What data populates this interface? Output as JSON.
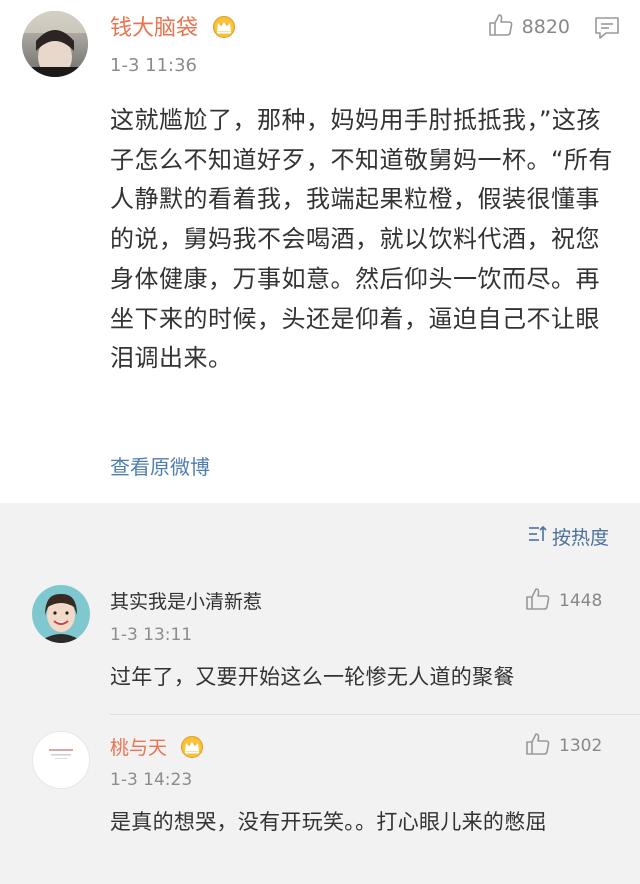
{
  "post": {
    "username": "钱大脑袋",
    "vip_icon": "crown-badge-icon",
    "timestamp": "1-3 11:36",
    "like_count": "8820",
    "body": "这就尴尬了，那种，妈妈用手肘抵抵我，”这孩子怎么不知道好歹，不知道敬舅妈一杯。“所有人静默的看着我，我端起果粒橙，假装很懂事的说，舅妈我不会喝酒，就以饮料代酒，祝您身体健康，万事如意。然后仰头一饮而尽。再坐下来的时候，头还是仰着，逼迫自己不让眼泪调出来。",
    "view_original": "查看原微博"
  },
  "sort": {
    "label": "按热度"
  },
  "comments": [
    {
      "username": "其实我是小清新惹",
      "timestamp": "1-3 13:11",
      "like_count": "1448",
      "text": "过年了，又要开始这么一轮惨无人道的聚餐"
    },
    {
      "username": "桃与天",
      "timestamp": "1-3 14:23",
      "like_count": "1302",
      "text": "是真的想哭，没有开玩笑。。打心眼儿来的憋屈"
    }
  ],
  "colors": {
    "vip_name": "#eb7350",
    "link": "#507daf",
    "meta": "#8c8c8c",
    "background": "#f2f2f2"
  }
}
